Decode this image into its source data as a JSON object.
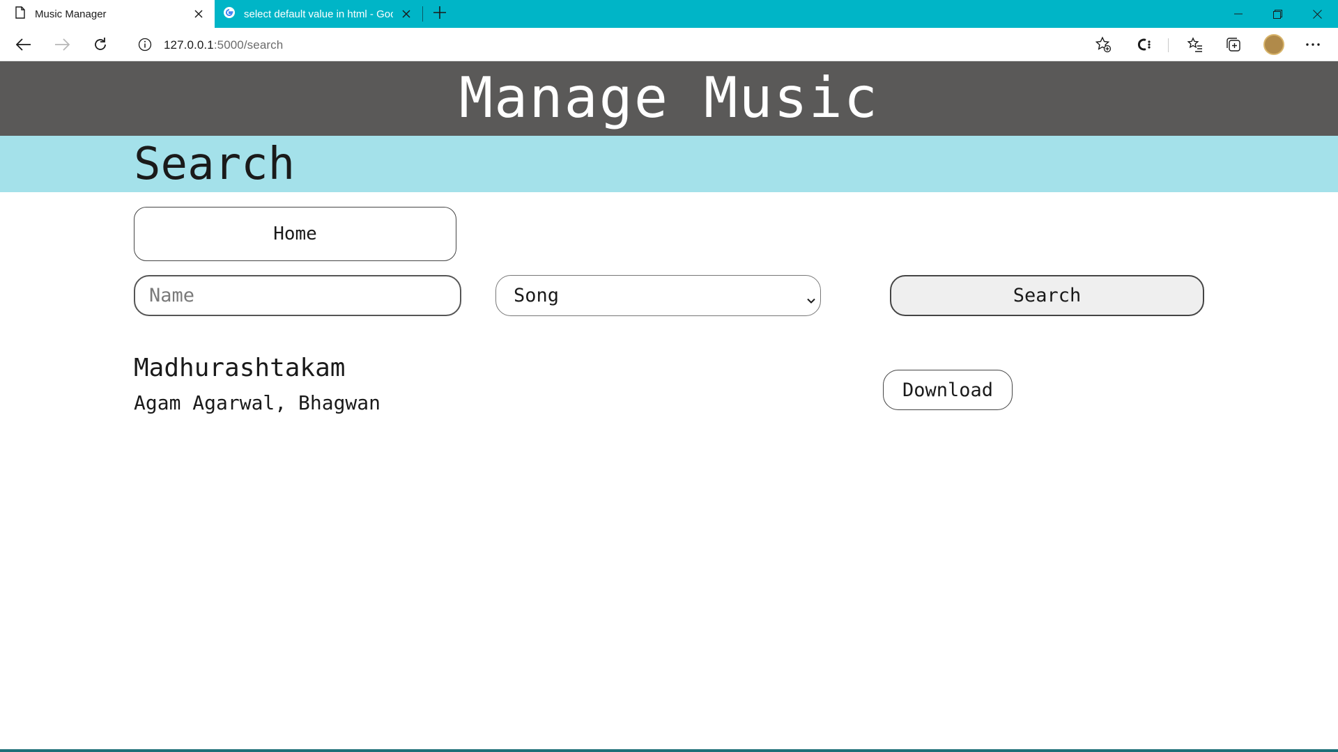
{
  "browser": {
    "tabs": [
      {
        "title": "Music Manager",
        "active": true,
        "icon": "page-icon"
      },
      {
        "title": "select default value in html - Google Search",
        "active": false,
        "icon": "google-icon"
      }
    ],
    "address": {
      "host": "127.0.0.1",
      "rest": ":5000/search"
    },
    "colors": {
      "tabstrip": "#00b5c7"
    }
  },
  "page": {
    "header_title": "Manage Music",
    "subheader_title": "Search",
    "home_label": "Home",
    "name_placeholder": "Name",
    "type_selected": "Song",
    "search_label": "Search",
    "results": [
      {
        "title": "Madhurashtakam",
        "artists": "Agam Agarwal, Bhagwan",
        "download_label": "Download"
      }
    ],
    "colors": {
      "header_bg": "#5a5958",
      "subheader_bg": "#a4e1ea"
    }
  }
}
